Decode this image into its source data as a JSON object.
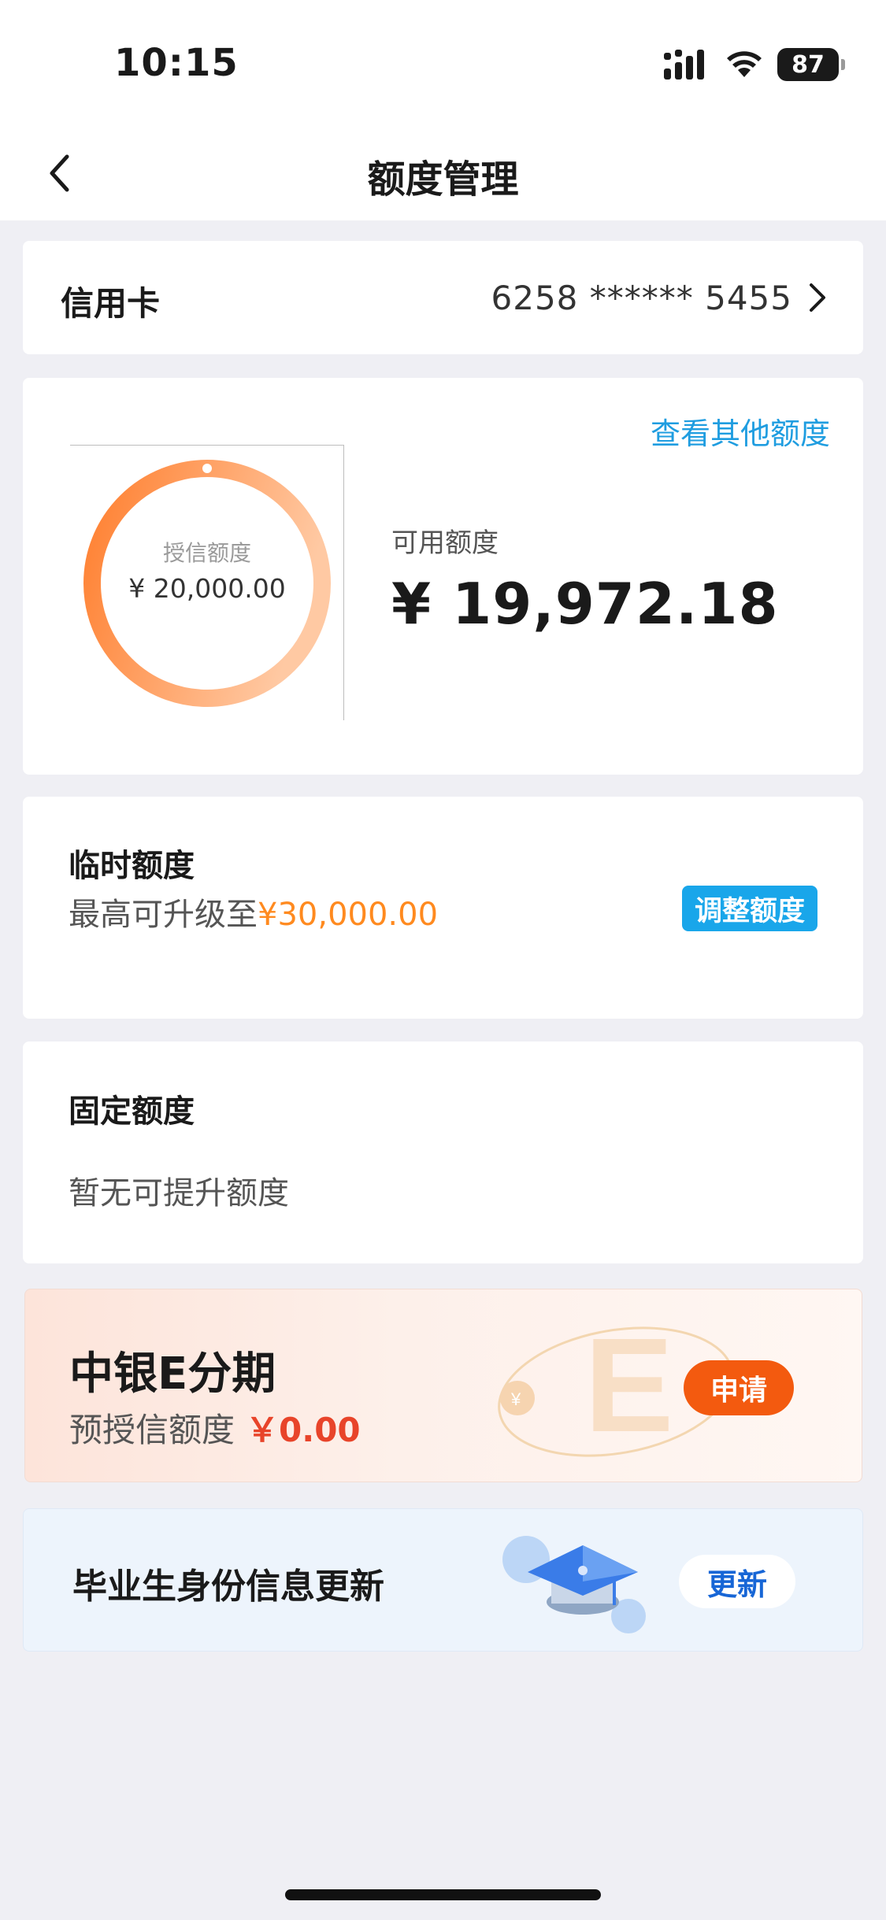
{
  "status_bar": {
    "time": "10:15",
    "battery": "87",
    "icons": [
      "signal-icon",
      "wifi-icon",
      "battery-icon"
    ]
  },
  "nav": {
    "title": "额度管理",
    "back_icon": "chevron-left-icon"
  },
  "card_row": {
    "label": "信用卡",
    "card_number": "6258 ****** 5455"
  },
  "credit": {
    "other_limits_link": "查看其他额度",
    "granted_label": "授信额度",
    "granted_value": "¥ 20,000.00",
    "available_label": "可用额度",
    "available_value": "¥ 19,972.18",
    "ring_color_start": "#ff7f2f",
    "ring_color_end": "#ffc9a3"
  },
  "temporary": {
    "title": "临时额度",
    "desc_prefix": "最高可升级至",
    "desc_amount": "¥30,000.00",
    "adjust_button": "调整额度"
  },
  "fixed": {
    "title": "固定额度",
    "desc": "暂无可提升额度"
  },
  "installment": {
    "title": "中银E分期",
    "desc_label": "预授信额度",
    "desc_amount": "￥0.00",
    "apply_button": "申请"
  },
  "graduate": {
    "title": "毕业生身份信息更新",
    "update_button": "更新",
    "icon": "graduation-cap-icon"
  },
  "colors": {
    "accent_blue": "#19a6ea",
    "link_blue": "#1f9de0",
    "orange": "#ff8a1f",
    "apply_orange": "#f35a0f",
    "red_amount": "#e8442a"
  }
}
